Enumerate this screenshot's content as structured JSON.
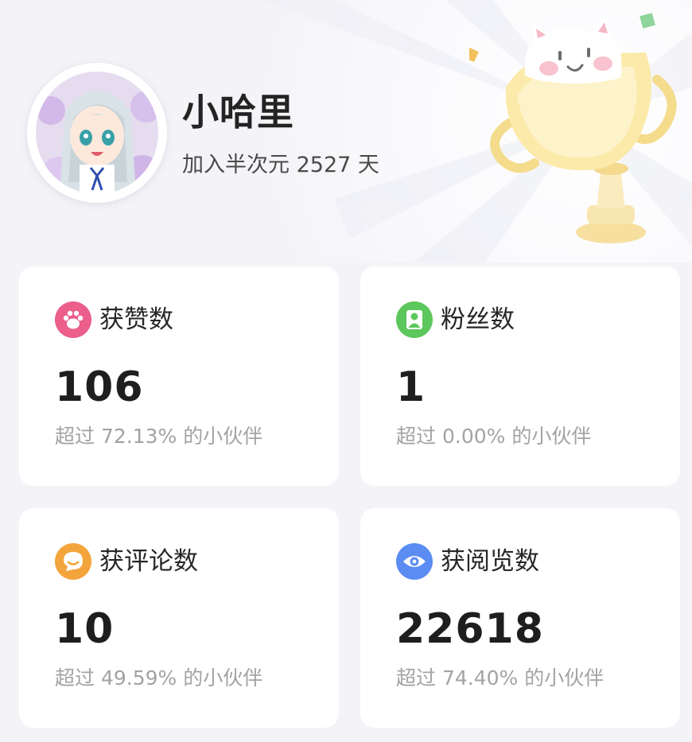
{
  "profile": {
    "username": "小哈里",
    "join_prefix": "加入半次元",
    "join_days": "2527",
    "join_suffix": "天"
  },
  "stats": [
    {
      "label": "获赞数",
      "value": "106",
      "percentile": "72.13%",
      "icon": "paw-icon",
      "color": "#ec5e8c"
    },
    {
      "label": "粉丝数",
      "value": "1",
      "percentile": "0.00%",
      "icon": "user-icon",
      "color": "#5cc75c"
    },
    {
      "label": "获评论数",
      "value": "10",
      "percentile": "49.59%",
      "icon": "comment-bubble-icon",
      "color": "#f3a43b"
    },
    {
      "label": "获阅览数",
      "value": "22618",
      "percentile": "74.40%",
      "icon": "eye-icon",
      "color": "#5b8cf2"
    }
  ],
  "sub_prefix": "超过",
  "sub_suffix": "的小伙伴",
  "decoration": {
    "trophy": "cat-in-trophy-illustration"
  }
}
